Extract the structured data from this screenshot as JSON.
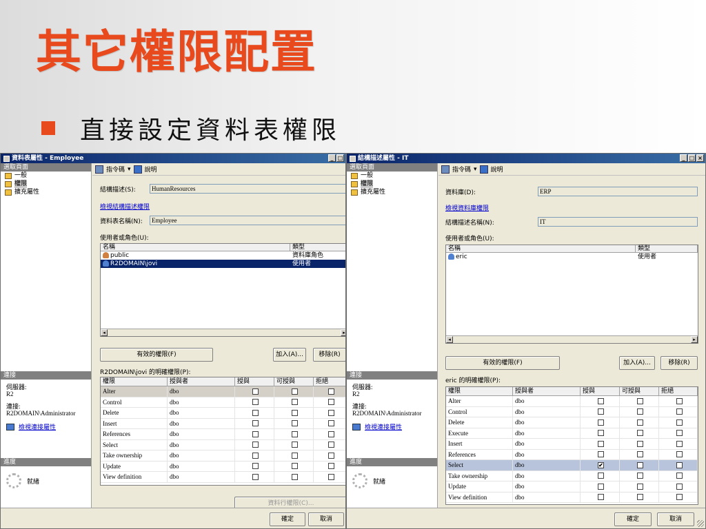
{
  "slide": {
    "title": "其它權限配置",
    "bullet": "直接設定資料表權限"
  },
  "colors": {
    "title": "#e8491d",
    "selection": "#0a246a",
    "titlebar": "#0a246a"
  },
  "win1": {
    "title": "資料表屬性 - Employee",
    "select_page": "選取頁面",
    "nav": [
      "一般",
      "權限",
      "擴充屬性"
    ],
    "toolbar": {
      "script": "指令碼",
      "help": "說明"
    },
    "schema_label": "結構描述(S):",
    "schema_value": "HumanResources",
    "schema_link": "檢視結構描述權限",
    "table_label": "資料表名稱(N):",
    "table_value": "Employee",
    "users_label": "使用者或角色(U):",
    "list_headers": [
      "名稱",
      "類型"
    ],
    "list_rows": [
      {
        "name": "public",
        "type": "資料庫角色"
      },
      {
        "name": "R2DOMAIN\\jovi",
        "type": "使用者"
      }
    ],
    "effective_btn": "有效的權限(F)",
    "add_btn": "加入(A)...",
    "remove_btn": "移除(R)",
    "explicit_label": "R2DOMAIN\\jovi 的明確權限(P):",
    "grid_headers": [
      "權限",
      "授與者",
      "授與",
      "可授與",
      "拒絕"
    ],
    "grid_rows": [
      {
        "perm": "Alter",
        "grantor": "dbo",
        "grant": "",
        "with_grant": "",
        "deny": ""
      },
      {
        "perm": "Control",
        "grantor": "dbo",
        "grant": "",
        "with_grant": "",
        "deny": ""
      },
      {
        "perm": "Delete",
        "grantor": "dbo",
        "grant": "",
        "with_grant": "",
        "deny": ""
      },
      {
        "perm": "Insert",
        "grantor": "dbo",
        "grant": "",
        "with_grant": "",
        "deny": ""
      },
      {
        "perm": "References",
        "grantor": "dbo",
        "grant": "",
        "with_grant": "",
        "deny": ""
      },
      {
        "perm": "Select",
        "grantor": "dbo",
        "grant": "",
        "with_grant": "",
        "deny": ""
      },
      {
        "perm": "Take ownership",
        "grantor": "dbo",
        "grant": "",
        "with_grant": "",
        "deny": ""
      },
      {
        "perm": "Update",
        "grantor": "dbo",
        "grant": "",
        "with_grant": "",
        "deny": ""
      },
      {
        "perm": "View definition",
        "grantor": "dbo",
        "grant": "",
        "with_grant": "",
        "deny": ""
      }
    ],
    "column_perm_btn": "資料行權限(C)...",
    "ok_btn": "確定",
    "cancel_btn": "取消"
  },
  "win2": {
    "title": "結構描述屬性 - IT",
    "select_page": "選取頁面",
    "nav": [
      "一般",
      "權限",
      "擴充屬性"
    ],
    "toolbar": {
      "script": "指令碼",
      "help": "說明"
    },
    "db_label": "資料庫(D):",
    "db_value": "ERP",
    "db_link": "檢視資料庫權限",
    "schema_label": "結構描述名稱(N):",
    "schema_value": "IT",
    "users_label": "使用者或角色(U):",
    "list_headers": [
      "名稱",
      "類型"
    ],
    "list_rows": [
      {
        "name": "eric",
        "type": "使用者"
      }
    ],
    "effective_btn": "有效的權限(F)",
    "add_btn": "加入(A)...",
    "remove_btn": "移除(R)",
    "explicit_label": "eric 的明確權限(P):",
    "grid_headers": [
      "權限",
      "授與者",
      "授與",
      "可授與",
      "拒絕"
    ],
    "grid_rows": [
      {
        "perm": "Alter",
        "grantor": "dbo",
        "grant": "",
        "with_grant": "",
        "deny": ""
      },
      {
        "perm": "Control",
        "grantor": "dbo",
        "grant": "",
        "with_grant": "",
        "deny": ""
      },
      {
        "perm": "Delete",
        "grantor": "dbo",
        "grant": "",
        "with_grant": "",
        "deny": ""
      },
      {
        "perm": "Execute",
        "grantor": "dbo",
        "grant": "",
        "with_grant": "",
        "deny": ""
      },
      {
        "perm": "Insert",
        "grantor": "dbo",
        "grant": "",
        "with_grant": "",
        "deny": ""
      },
      {
        "perm": "References",
        "grantor": "dbo",
        "grant": "",
        "with_grant": "",
        "deny": ""
      },
      {
        "perm": "Select",
        "grantor": "dbo",
        "grant": "✔",
        "with_grant": "",
        "deny": ""
      },
      {
        "perm": "Take ownership",
        "grantor": "dbo",
        "grant": "",
        "with_grant": "",
        "deny": ""
      },
      {
        "perm": "Update",
        "grantor": "dbo",
        "grant": "",
        "with_grant": "",
        "deny": ""
      },
      {
        "perm": "View definition",
        "grantor": "dbo",
        "grant": "",
        "with_grant": "",
        "deny": ""
      }
    ],
    "ok_btn": "確定",
    "cancel_btn": "取消"
  },
  "connection": {
    "header": "連接",
    "server_label": "伺服器:",
    "server_value": "R2",
    "conn_label": "連接:",
    "conn_value": "R2DOMAIN\\Administrator",
    "conn_link": "檢視連接屬性",
    "progress_header": "進度",
    "status": "就緒"
  }
}
